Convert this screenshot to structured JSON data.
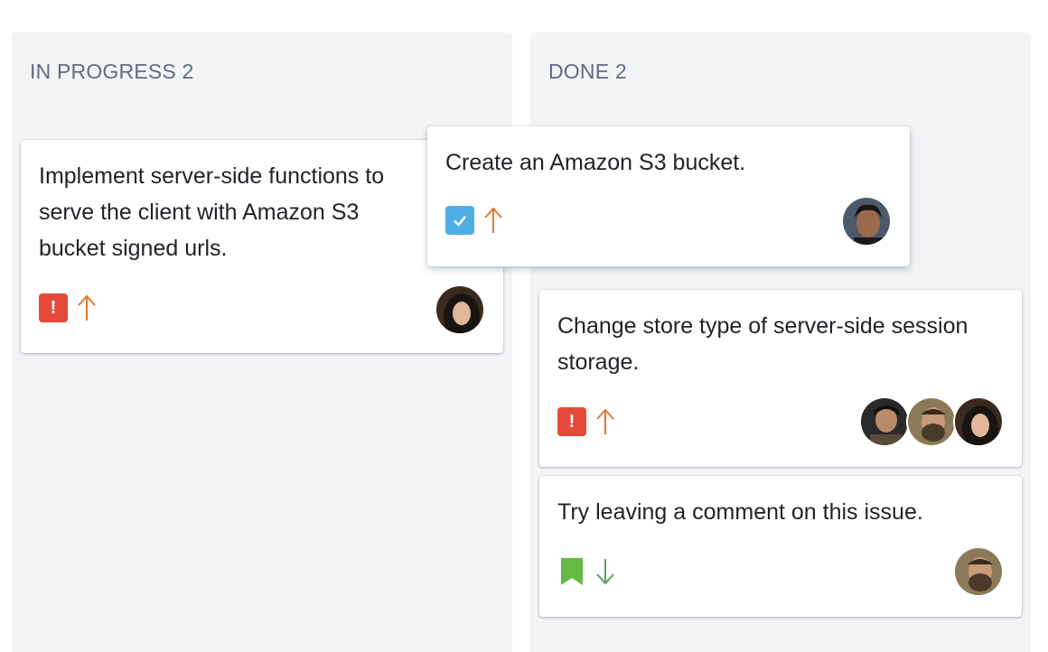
{
  "columns": [
    {
      "title": "IN PROGRESS 2"
    },
    {
      "title": "DONE 2"
    }
  ],
  "cards": {
    "card_1": {
      "title": "Implement server-side functions to serve the client with Amazon S3 bucket signed urls.",
      "type": "bug",
      "type_icon": "exclamation-icon",
      "type_color": "#e5493a",
      "priority": "high",
      "priority_icon": "arrow-up-icon",
      "priority_color": "#e07a2e",
      "assignees": [
        "avatar-woman-dark-hair"
      ]
    },
    "card_drag": {
      "title": "Create an Amazon S3 bucket.",
      "type": "task",
      "type_icon": "checkmark-icon",
      "type_color": "#4fade6",
      "priority": "high",
      "priority_icon": "arrow-up-icon",
      "priority_color": "#e07a2e",
      "assignees": [
        "avatar-man-curly-hair"
      ]
    },
    "card_2": {
      "title": "Change store type of server-side session storage.",
      "type": "bug",
      "type_icon": "exclamation-icon",
      "type_color": "#e5493a",
      "priority": "high",
      "priority_icon": "arrow-up-icon",
      "priority_color": "#e07a2e",
      "assignees": [
        "avatar-man-short-hair",
        "avatar-man-beard",
        "avatar-woman-dark-hair"
      ]
    },
    "card_3": {
      "title": "Try leaving a comment on this issue.",
      "type": "story",
      "type_icon": "bookmark-icon",
      "type_color": "#65ba43",
      "priority": "low",
      "priority_icon": "arrow-down-icon",
      "priority_color": "#57a55a",
      "assignees": [
        "avatar-man-beard"
      ]
    }
  },
  "bug_glyph": "!"
}
